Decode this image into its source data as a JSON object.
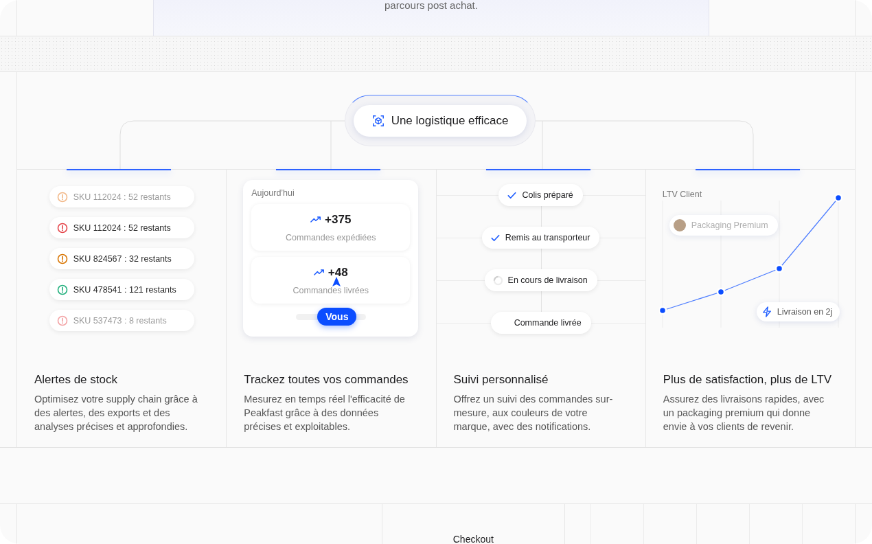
{
  "intro": {
    "text": "parcours post achat."
  },
  "hub": {
    "label": "Une logistique efficace"
  },
  "features": [
    {
      "kind": "stock",
      "title": "Alertes de stock",
      "description": "Optimisez votre supply chain grâce à des alertes, des exports et des analyses précises et approfondies.",
      "alerts": [
        {
          "label": "SKU 112024 : 52 restants",
          "color": "#f2b98a",
          "faded": true
        },
        {
          "label": "SKU 112024 : 52 restants",
          "color": "#e5484d",
          "faded": false
        },
        {
          "label": "SKU 824567 : 32 restants",
          "color": "#d97706",
          "faded": false
        },
        {
          "label": "SKU 478541 : 121 restants",
          "color": "#22b07d",
          "faded": false
        },
        {
          "label": "SKU 537473 : 8 restants",
          "color": "#f3a3a5",
          "faded": true
        }
      ]
    },
    {
      "kind": "tracking",
      "title": "Trackez toutes vos commandes",
      "description": "Mesurez en temps réel l'efficacité de Peakfast grâce à des données précises et exploitables.",
      "caption": "Aujourd’hui",
      "stats": [
        {
          "value": "+375",
          "label": "Commandes expédiées"
        },
        {
          "value": "+48",
          "label": "Commandes livrées"
        }
      ],
      "cursor": "Vous"
    },
    {
      "kind": "steps",
      "title": "Suivi personnalisé",
      "description": "Offrez un suivi des commandes sur-mesure, aux couleurs de votre marque, avec des notifications.",
      "steps": [
        {
          "label": "Colis préparé",
          "kind": "done"
        },
        {
          "label": "Remis au transporteur",
          "kind": "done"
        },
        {
          "label": "En cours de livraison",
          "kind": "progress"
        },
        {
          "label": "Commande livrée",
          "kind": "pending"
        }
      ]
    },
    {
      "kind": "ltv",
      "title": "Plus de satisfaction, plus de LTV",
      "description": "Assurez des livraisons rapides, avec un packaging premium qui donne envie à vos clients de revenir.",
      "caption": "LTV Client",
      "badge_blurred": "Packaging Premium",
      "badge": "Livraison en 2j"
    }
  ],
  "next_section": {
    "label": "Checkout"
  }
}
